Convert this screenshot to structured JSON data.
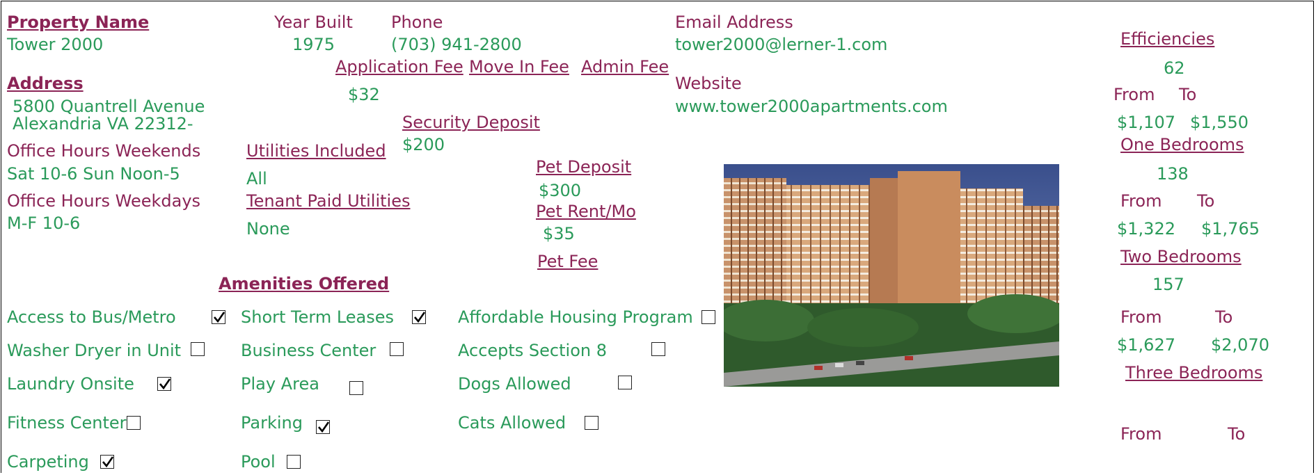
{
  "property": {
    "name_label": "Property Name",
    "name": "Tower 2000",
    "address_label": "Address",
    "address_line1": "5800 Quantrell Avenue",
    "address_line2": "Alexandria VA 22312-"
  },
  "office": {
    "weekends_label": "Office Hours Weekends",
    "weekends": "Sat 10-6 Sun Noon-5",
    "weekdays_label": "Office Hours Weekdays",
    "weekdays": "M-F 10-6"
  },
  "details": {
    "year_label": "Year Built",
    "year": "1975",
    "phone_label": "Phone",
    "phone": "(703) 941-2800",
    "app_fee_label": "Application Fee",
    "app_fee": "$32",
    "move_in_fee_label": "Move In Fee",
    "admin_fee_label": "Admin Fee",
    "security_label": "Security Deposit",
    "security": "$200",
    "utilities_label": "Utilities Included",
    "utilities": "All",
    "tenant_utilities_label": "Tenant Paid Utilities",
    "tenant_utilities": "None",
    "pet_deposit_label": "Pet Deposit",
    "pet_deposit": "$300",
    "pet_rent_label": "Pet Rent/Mo",
    "pet_rent": "$35",
    "pet_fee_label": "Pet Fee"
  },
  "contact": {
    "email_label": "Email Address",
    "email": "tower2000@lerner-1.com",
    "website_label": "Website",
    "website": "www.tower2000apartments.com"
  },
  "amenities": {
    "title": "Amenities Offered",
    "items": [
      {
        "label": "Access to Bus/Metro",
        "checked": true
      },
      {
        "label": "Short Term Leases",
        "checked": true
      },
      {
        "label": "Affordable Housing Program",
        "checked": false
      },
      {
        "label": "Washer Dryer in Unit",
        "checked": false
      },
      {
        "label": "Business Center",
        "checked": false
      },
      {
        "label": "Accepts Section 8",
        "checked": false
      },
      {
        "label": "Laundry Onsite",
        "checked": true
      },
      {
        "label": "Play Area",
        "checked": false
      },
      {
        "label": "Dogs Allowed",
        "checked": false
      },
      {
        "label": "Fitness Center",
        "checked": false
      },
      {
        "label": "Parking",
        "checked": true
      },
      {
        "label": "Cats Allowed",
        "checked": false
      },
      {
        "label": "Carpeting",
        "checked": true
      },
      {
        "label": "Pool",
        "checked": false
      }
    ]
  },
  "units": [
    {
      "label": "Efficiencies ",
      "count": "62",
      "from_label": "From",
      "to_label": "To",
      "from": "$1,107",
      "to": "$1,550"
    },
    {
      "label": "One Bedrooms",
      "count": "138",
      "from_label": "From",
      "to_label": "To",
      "from": "$1,322",
      "to": "$1,765"
    },
    {
      "label": "Two Bedrooms",
      "count": "157",
      "from_label": "From",
      "to_label": "To",
      "from": "$1,627",
      "to": "$2,070"
    },
    {
      "label": "Three Bedrooms",
      "count": "",
      "from_label": "From",
      "to_label": "To",
      "from": "",
      "to": ""
    }
  ],
  "colors": {
    "label": "#8b2456",
    "value": "#2a9a5a"
  }
}
